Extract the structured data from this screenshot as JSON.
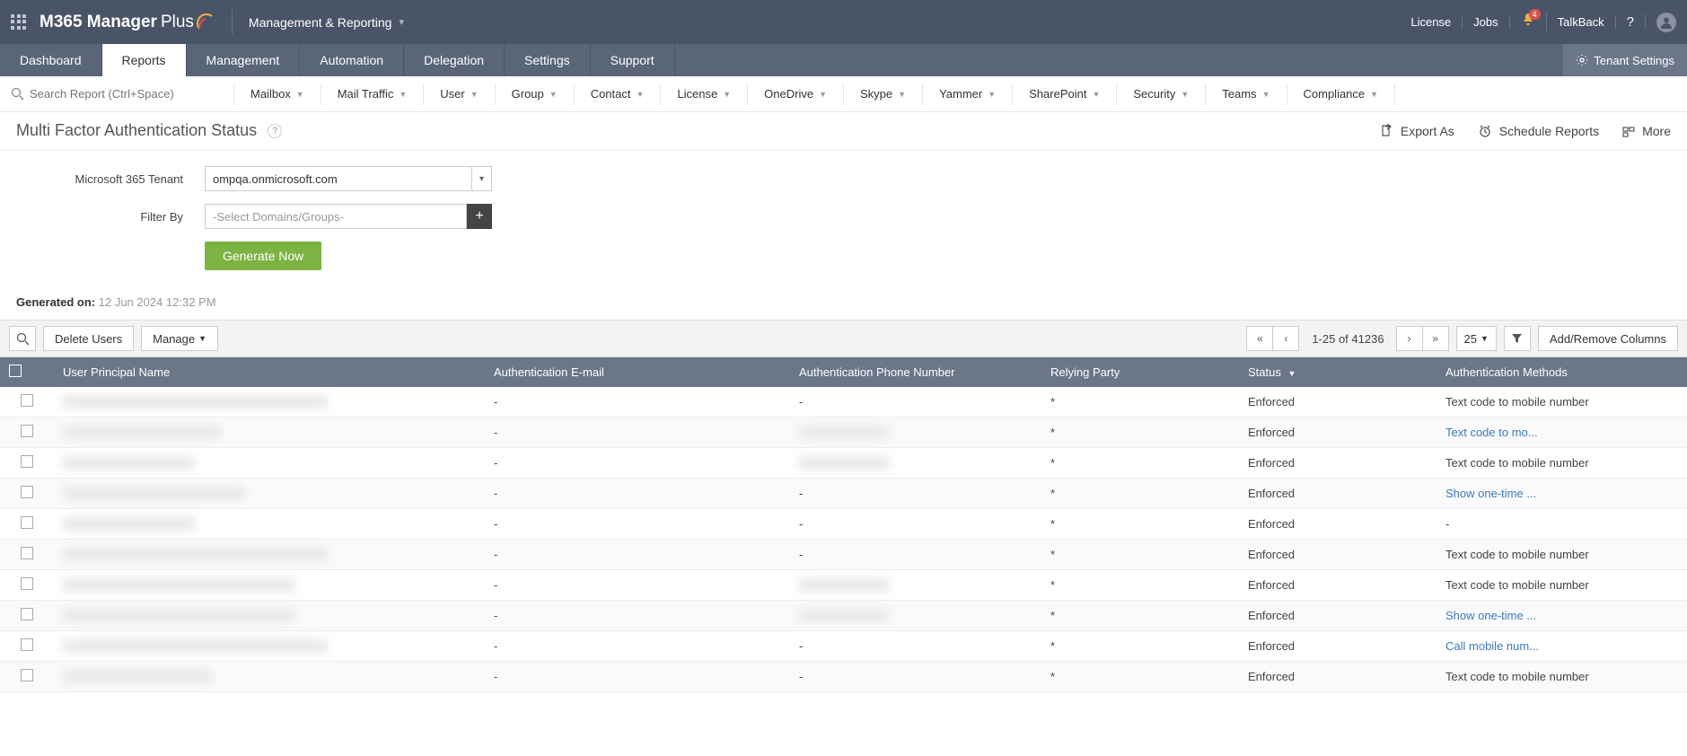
{
  "brand": {
    "name": "M365 Manager",
    "suffix": "Plus"
  },
  "context": {
    "label": "Management & Reporting"
  },
  "topLinks": {
    "license": "License",
    "jobs": "Jobs",
    "talkback": "TalkBack",
    "badge": "4"
  },
  "tabs": [
    "Dashboard",
    "Reports",
    "Management",
    "Automation",
    "Delegation",
    "Settings",
    "Support"
  ],
  "activeTab": "Reports",
  "tenantSettings": "Tenant Settings",
  "search": {
    "placeholder": "Search Report (Ctrl+Space)"
  },
  "categories": [
    "Mailbox",
    "Mail Traffic",
    "User",
    "Group",
    "Contact",
    "License",
    "OneDrive",
    "Skype",
    "Yammer",
    "SharePoint",
    "Security",
    "Teams",
    "Compliance"
  ],
  "page": {
    "title": "Multi Factor Authentication Status",
    "exportAs": "Export As",
    "scheduleReports": "Schedule Reports",
    "more": "More"
  },
  "form": {
    "tenantLabel": "Microsoft 365 Tenant",
    "tenantValue": "ompqa.onmicrosoft.com",
    "filterByLabel": "Filter By",
    "filterPlaceholder": "-Select Domains/Groups-",
    "generate": "Generate Now"
  },
  "generated": {
    "label": "Generated on:",
    "value": "12 Jun 2024 12:32 PM"
  },
  "toolbar": {
    "deleteUsers": "Delete Users",
    "manage": "Manage",
    "pager": "1-25 of 41236",
    "pageSize": "25",
    "addRemove": "Add/Remove Columns"
  },
  "columns": {
    "upn": "User Principal Name",
    "email": "Authentication E-mail",
    "phone": "Authentication Phone Number",
    "relying": "Relying Party",
    "status": "Status",
    "methods": "Authentication Methods"
  },
  "rows": [
    {
      "upn": "████████████████████████████████",
      "email": "-",
      "phone": "-",
      "relying": "*",
      "status": "Enforced",
      "methods": "Text code to mobile number",
      "upnBlur": true,
      "phoneBlur": false
    },
    {
      "upn": "███████████████████",
      "email": "-",
      "phone": "████████",
      "relying": "*",
      "status": "Enforced",
      "methods": "Text code to mo...",
      "upnBlur": true,
      "phoneBlur": true,
      "methodsLink": true
    },
    {
      "upn": "████████████████",
      "email": "-",
      "phone": "████████",
      "relying": "*",
      "status": "Enforced",
      "methods": "Text code to mobile number",
      "upnBlur": true,
      "phoneBlur": true
    },
    {
      "upn": "██████████████████████",
      "email": "-",
      "phone": "-",
      "relying": "*",
      "status": "Enforced",
      "methods": "Show one-time ...",
      "upnBlur": true,
      "phoneBlur": false,
      "methodsLink": true
    },
    {
      "upn": "████████████████",
      "email": "-",
      "phone": "-",
      "relying": "*",
      "status": "Enforced",
      "methods": "-",
      "upnBlur": true,
      "phoneBlur": false
    },
    {
      "upn": "████████████████████████████████",
      "email": "-",
      "phone": "-",
      "relying": "*",
      "status": "Enforced",
      "methods": "Text code to mobile number",
      "upnBlur": true,
      "phoneBlur": false
    },
    {
      "upn": "████████████████████████████",
      "email": "-",
      "phone": "████████",
      "relying": "*",
      "status": "Enforced",
      "methods": "Text code to mobile number",
      "upnBlur": true,
      "phoneBlur": true
    },
    {
      "upn": "████████████████████████████",
      "email": "-",
      "phone": "████████",
      "relying": "*",
      "status": "Enforced",
      "methods": "Show one-time ...",
      "upnBlur": true,
      "phoneBlur": true,
      "methodsLink": true
    },
    {
      "upn": "████████████████████████████████",
      "email": "-",
      "phone": "-",
      "relying": "*",
      "status": "Enforced",
      "methods": "Call mobile num...",
      "upnBlur": true,
      "phoneBlur": false,
      "methodsLink": true
    },
    {
      "upn": "██████████████████",
      "email": "-",
      "phone": "-",
      "relying": "*",
      "status": "Enforced",
      "methods": "Text code to mobile number",
      "upnBlur": true,
      "phoneBlur": false
    }
  ]
}
